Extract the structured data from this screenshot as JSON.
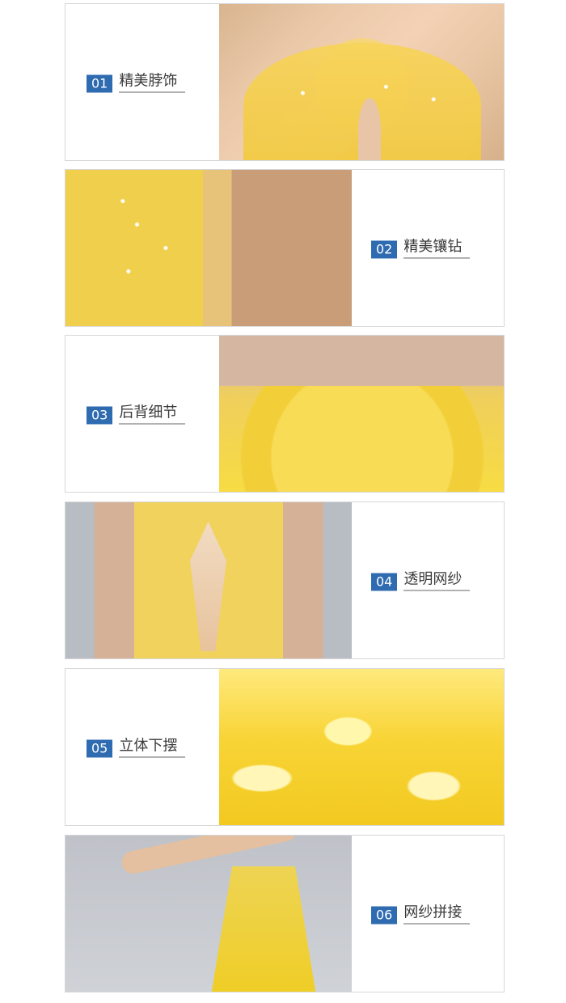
{
  "panels": [
    {
      "number": "01",
      "title": "精美脖饰"
    },
    {
      "number": "02",
      "title": "精美镶钻"
    },
    {
      "number": "03",
      "title": "后背细节"
    },
    {
      "number": "04",
      "title": "透明网纱"
    },
    {
      "number": "05",
      "title": "立体下摆"
    },
    {
      "number": "06",
      "title": "网纱拼接"
    }
  ]
}
